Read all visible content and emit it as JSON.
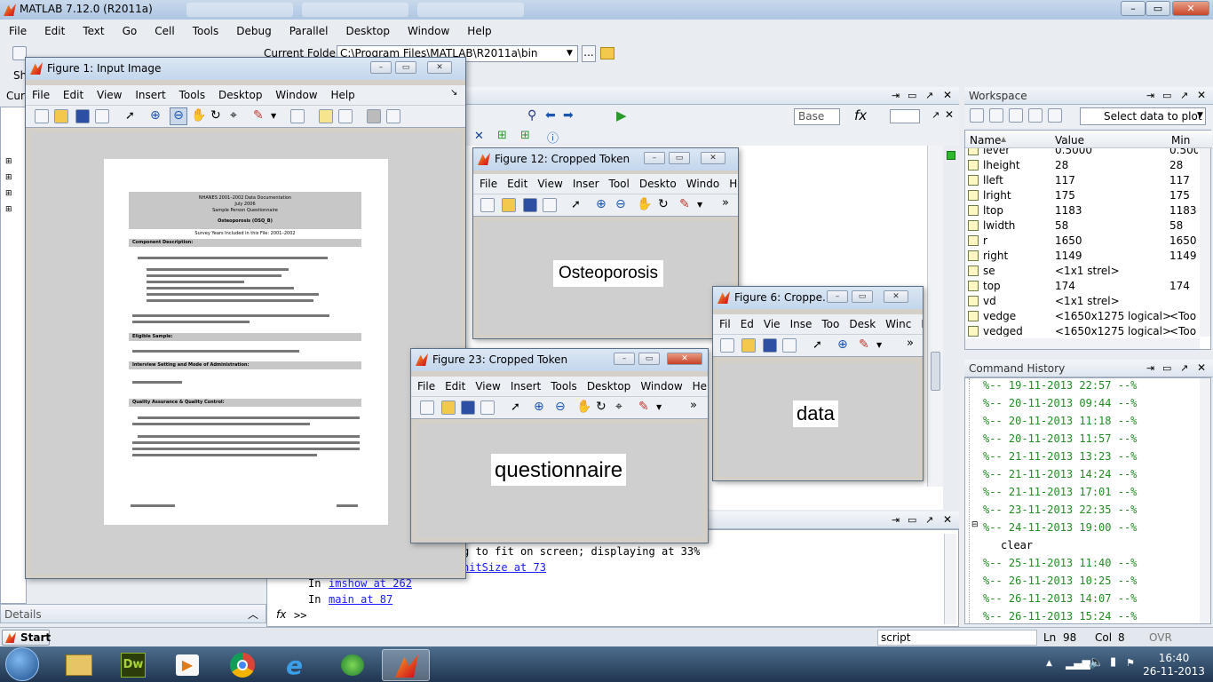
{
  "main_window": {
    "title": "MATLAB  7.12.0 (R2011a)",
    "menu": [
      "File",
      "Edit",
      "Text",
      "Go",
      "Cell",
      "Tools",
      "Debug",
      "Parallel",
      "Desktop",
      "Window",
      "Help"
    ],
    "current_folder_label": "Current Folder:",
    "current_folder_path": "C:\\Program Files\\MATLAB\\R2011a\\bin",
    "browse_label": "...",
    "sh_label": "Sh",
    "cur_label": "Cur",
    "details_label": "Details",
    "start_label": "Start"
  },
  "workspace": {
    "title": "Workspace",
    "select_data_label": "Select data to plot",
    "columns": {
      "name": "Name",
      "value": "Value",
      "min": "Min"
    },
    "rows": [
      {
        "name": "lever",
        "value": "0.5000",
        "min": "0.5000"
      },
      {
        "name": "lheight",
        "value": "28",
        "min": "28"
      },
      {
        "name": "lleft",
        "value": "117",
        "min": "117"
      },
      {
        "name": "lright",
        "value": "175",
        "min": "175"
      },
      {
        "name": "ltop",
        "value": "1183",
        "min": "1183"
      },
      {
        "name": "lwidth",
        "value": "58",
        "min": "58"
      },
      {
        "name": "r",
        "value": "1650",
        "min": "1650"
      },
      {
        "name": "right",
        "value": "1149",
        "min": "1149"
      },
      {
        "name": "se",
        "value": "<1x1 strel>",
        "min": ""
      },
      {
        "name": "top",
        "value": "174",
        "min": "174"
      },
      {
        "name": "vd",
        "value": "<1x1 strel>",
        "min": ""
      },
      {
        "name": "vedge",
        "value": "<1650x1275 logical>",
        "min": "<Too"
      },
      {
        "name": "vedged",
        "value": "<1650x1275 logical>",
        "min": "<Too"
      }
    ]
  },
  "command_history": {
    "title": "Command History",
    "entries": [
      "%-- 19-11-2013 22:57 --%",
      "%-- 20-11-2013 09:44 --%",
      "%-- 20-11-2013 11:18 --%",
      "%-- 20-11-2013 11:57 --%",
      "%-- 21-11-2013 13:23 --%",
      "%-- 21-11-2013 14:24 --%",
      "%-- 21-11-2013 17:01 --%",
      "%-- 23-11-2013 22:35 --%",
      "%-- 24-11-2013 19:00 --%",
      "clear",
      "%-- 25-11-2013 11:40 --%",
      "%-- 26-11-2013 10:25 --%",
      "%-- 26-11-2013 14:07 --%",
      "%-- 26-11-2013 15:24 --%"
    ]
  },
  "editor": {
    "base_label": "Base",
    "fx_label": "fx"
  },
  "command_window": {
    "line1": "g to fit on screen; displaying at 33%",
    "line2_link": "nitSize at 73",
    "line3_prefix": "In ",
    "line3_link": "imshow at 262",
    "line4_prefix": "In ",
    "line4_link": "main at 87",
    "prompt": ">>"
  },
  "status_bar": {
    "mode": "script",
    "ln_label": "Ln",
    "ln_value": "98",
    "col_label": "Col",
    "col_value": "8",
    "ovr": "OVR"
  },
  "fig1": {
    "title": "Figure 1: Input Image",
    "menu": [
      "File",
      "Edit",
      "View",
      "Insert",
      "Tools",
      "Desktop",
      "Window",
      "Help"
    ],
    "doc": {
      "header1": "NHANES 2001–2002 Data Documentation",
      "header2": "July 2006",
      "header3": "Sample Person Questionnaire",
      "header4": "Osteoporosis (OSQ_B)",
      "subtitle": "Survey Years Included in this File: 2001–2002",
      "sec1": "Component Description:",
      "sec2": "Eligible Sample:",
      "sec3": "Interview Setting and Mode of Administration:",
      "sec4": "Quality Assurance & Quality Control:"
    }
  },
  "fig12": {
    "title": "Figure 12: Cropped Token",
    "menu": [
      "File",
      "Edit",
      "View",
      "Inser",
      "Tool",
      "Deskto",
      "Windo",
      "Help"
    ],
    "token": "Osteoporosis"
  },
  "fig6": {
    "title": "Figure 6: Croppe...",
    "menu": [
      "Fil",
      "Ed",
      "Vie",
      "Inse",
      "Too",
      "Desk",
      "Winc",
      "He"
    ],
    "token": "data"
  },
  "fig23": {
    "title": "Figure 23: Cropped Token",
    "menu": [
      "File",
      "Edit",
      "View",
      "Insert",
      "Tools",
      "Desktop",
      "Window",
      "Help"
    ],
    "token": "questionnaire"
  },
  "taskbar": {
    "time": "16:40",
    "date": "26-11-2013"
  }
}
